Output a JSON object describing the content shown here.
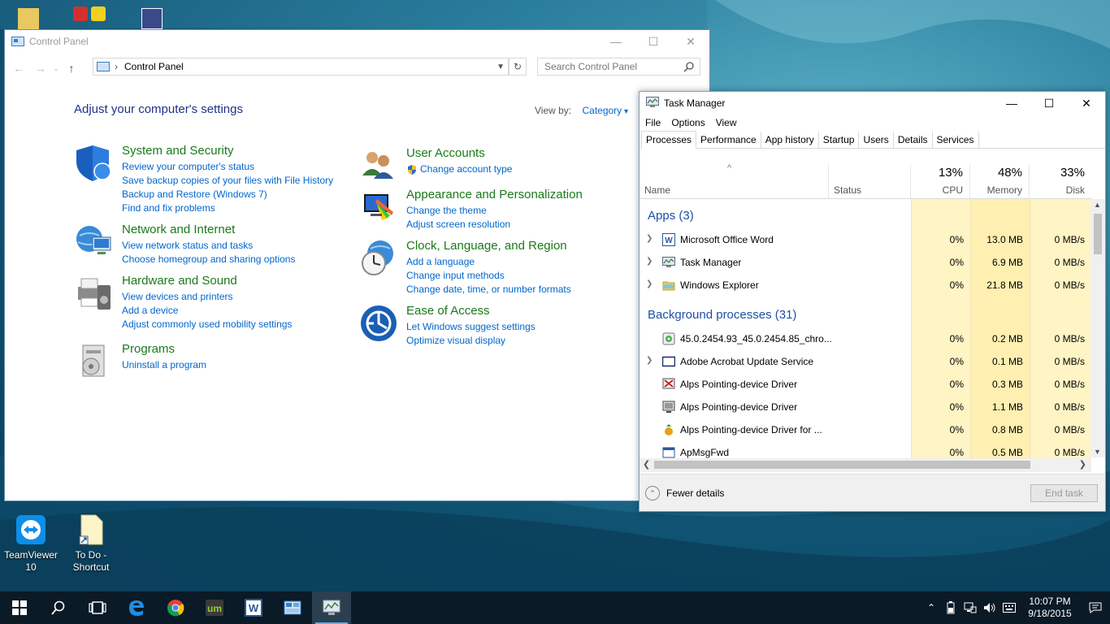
{
  "control_panel": {
    "title": "Control Panel",
    "breadcrumb": "Control Panel",
    "search_placeholder": "Search Control Panel",
    "heading": "Adjust your computer's settings",
    "view_by_label": "View by:",
    "view_by_value": "Category",
    "categories": [
      {
        "title": "System and Security",
        "icon": "shield-icon",
        "links": [
          "Review your computer's status",
          "Save backup copies of your files with File History",
          "Backup and Restore (Windows 7)",
          "Find and fix problems"
        ]
      },
      {
        "title": "Network and Internet",
        "icon": "globe-network-icon",
        "links": [
          "View network status and tasks",
          "Choose homegroup and sharing options"
        ]
      },
      {
        "title": "Hardware and Sound",
        "icon": "printer-icon",
        "links": [
          "View devices and printers",
          "Add a device",
          "Adjust commonly used mobility settings"
        ]
      },
      {
        "title": "Programs",
        "icon": "programs-icon",
        "links": [
          "Uninstall a program"
        ]
      },
      {
        "title": "User Accounts",
        "icon": "users-icon",
        "links": [
          "Change account type"
        ]
      },
      {
        "title": "Appearance and Personalization",
        "icon": "monitor-palette-icon",
        "links": [
          "Change the theme",
          "Adjust screen resolution"
        ]
      },
      {
        "title": "Clock, Language, and Region",
        "icon": "clock-globe-icon",
        "links": [
          "Add a language",
          "Change input methods",
          "Change date, time, or number formats"
        ]
      },
      {
        "title": "Ease of Access",
        "icon": "ease-of-access-icon",
        "links": [
          "Let Windows suggest settings",
          "Optimize visual display"
        ]
      }
    ]
  },
  "task_manager": {
    "title": "Task Manager",
    "menu": [
      "File",
      "Options",
      "View"
    ],
    "tabs": [
      "Processes",
      "Performance",
      "App history",
      "Startup",
      "Users",
      "Details",
      "Services"
    ],
    "active_tab": "Processes",
    "columns": {
      "name": "Name",
      "status": "Status",
      "cpu": {
        "pct": "13%",
        "label": "CPU"
      },
      "memory": {
        "pct": "48%",
        "label": "Memory"
      },
      "disk": {
        "pct": "33%",
        "label": "Disk"
      }
    },
    "groups": {
      "apps": "Apps (3)",
      "background": "Background processes (31)"
    },
    "apps": [
      {
        "name": "Microsoft Office Word",
        "cpu": "0%",
        "memory": "13.0 MB",
        "disk": "0 MB/s",
        "expandable": true
      },
      {
        "name": "Task Manager",
        "cpu": "0%",
        "memory": "6.9 MB",
        "disk": "0 MB/s",
        "expandable": true
      },
      {
        "name": "Windows Explorer",
        "cpu": "0%",
        "memory": "21.8 MB",
        "disk": "0 MB/s",
        "expandable": true
      }
    ],
    "background": [
      {
        "name": "45.0.2454.93_45.0.2454.85_chro...",
        "cpu": "0%",
        "memory": "0.2 MB",
        "disk": "0 MB/s",
        "expandable": false
      },
      {
        "name": "Adobe Acrobat Update Service",
        "cpu": "0%",
        "memory": "0.1 MB",
        "disk": "0 MB/s",
        "expandable": true
      },
      {
        "name": "Alps Pointing-device Driver",
        "cpu": "0%",
        "memory": "0.3 MB",
        "disk": "0 MB/s",
        "expandable": false
      },
      {
        "name": "Alps Pointing-device Driver",
        "cpu": "0%",
        "memory": "1.1 MB",
        "disk": "0 MB/s",
        "expandable": false
      },
      {
        "name": "Alps Pointing-device Driver for ...",
        "cpu": "0%",
        "memory": "0.8 MB",
        "disk": "0 MB/s",
        "expandable": false
      },
      {
        "name": "ApMsgFwd",
        "cpu": "0%",
        "memory": "0.5 MB",
        "disk": "0 MB/s",
        "expandable": false
      }
    ],
    "fewer_details": "Fewer details",
    "end_task": "End task"
  },
  "desktop_icons": [
    {
      "label": "TeamViewer 10",
      "icon": "teamviewer-icon"
    },
    {
      "label": "To Do - Shortcut",
      "icon": "document-shortcut-icon"
    }
  ],
  "taskbar": {
    "time": "10:07 PM",
    "date": "9/18/2015"
  }
}
